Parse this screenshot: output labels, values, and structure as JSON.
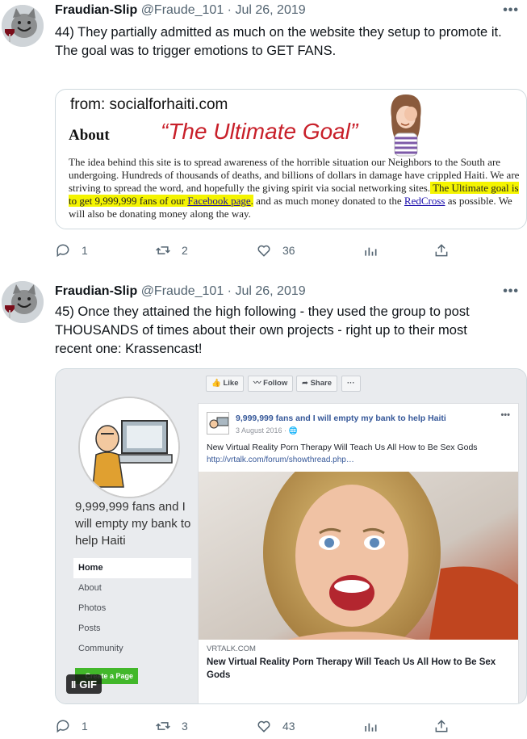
{
  "tweets": [
    {
      "name": "Fraudian-Slip",
      "handle": "@Fraude_101",
      "sep": "·",
      "date": "Jul 26, 2019",
      "more": "•••",
      "text_lines": [
        "44) They partially admitted as much on the website they setup to promote it.",
        "The goal was to trigger emotions to GET FANS."
      ],
      "counts": {
        "reply": "1",
        "retweet": "2",
        "like": "36"
      }
    },
    {
      "name": "Fraudian-Slip",
      "handle": "@Fraude_101",
      "sep": "·",
      "date": "Jul 26, 2019",
      "more": "•••",
      "text_lines": [
        "45) Once they attained the high following - they used the group to post THOUSANDS of times about their own projects - right up to their most recent one: Krassencast!"
      ],
      "counts": {
        "reply": "1",
        "retweet": "3",
        "like": "43"
      }
    }
  ],
  "card1": {
    "from": "from: socialforhaiti.com",
    "about": "About",
    "goal": "“The Ultimate Goal”",
    "para_a": "The idea behind this site is to spread awareness of the horrible situation our Neighbors to the South are undergoing. Hundreds of thousands of deaths, and billions of dollars in damage have crippled Haiti. We are striving to spread the word, and hopefully the giving spirit via social networking sites.",
    "para_hl_a": " The Ultimate goal is to get 9,999,999 fans of our ",
    "para_fb": "Facebook page",
    "para_hl_b": ".",
    "para_b": " and as much money donated to the ",
    "para_rc": "RedCross",
    "para_c": " as possible. We will also be donating money along the way."
  },
  "card2": {
    "page_name": "9,999,999 fans and I will empty my bank to help Haiti",
    "nav": [
      "Home",
      "About",
      "Photos",
      "Posts",
      "Community"
    ],
    "create_btn": "Create a Page",
    "gif_pause": "II",
    "gif_label": "GIF",
    "top_buttons": [
      "👍 Like",
      "〰 Follow",
      "➦ Share",
      "···"
    ],
    "post_title": "9,999,999 fans and I will empty my bank to help Haiti",
    "post_date": "3 August 2016 · 🌐",
    "post_more": "•••",
    "post_text": "New Virtual Reality Porn Therapy Will Teach Us All How to Be Sex Gods",
    "post_url": "http://vrtalk.com/forum/showthread.php…",
    "link_domain": "VRTALK.COM",
    "link_title": "New Virtual Reality Porn Therapy Will Teach Us All How to Be Sex Gods"
  },
  "colors": {
    "accent": "#1d9bf0",
    "muted": "#536471",
    "highlight": "#f4f400",
    "goal_red": "#c8202a",
    "fb_blue": "#365899"
  }
}
